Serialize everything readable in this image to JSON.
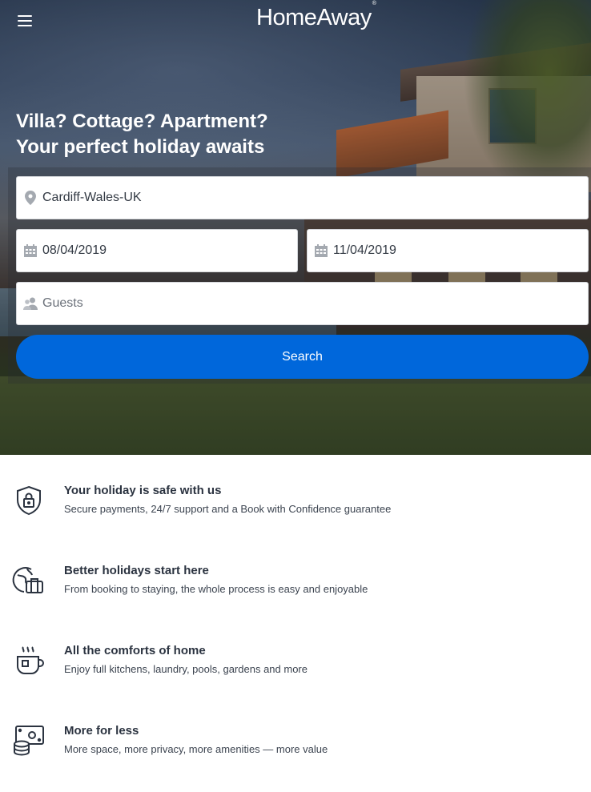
{
  "header": {
    "logo_text": "HomeAway",
    "logo_mark": "®",
    "menu_icon": "hamburger-menu-icon"
  },
  "hero": {
    "headline_line1": "Villa? Cottage? Apartment?",
    "headline_line2": "Your perfect holiday awaits"
  },
  "search": {
    "destination_value": "Cardiff-Wales-UK",
    "checkin_value": "08/04/2019",
    "checkout_value": "11/04/2019",
    "guests_placeholder": "Guests",
    "button_label": "Search",
    "button_color": "#0067db"
  },
  "features": [
    {
      "icon": "shield-lock-icon",
      "title": "Your holiday is safe with us",
      "description": "Secure payments, 24/7 support and a Book with Confidence guarantee"
    },
    {
      "icon": "globe-suitcase-icon",
      "title": "Better holidays start here",
      "description": "From booking to staying, the whole process is easy and enjoyable"
    },
    {
      "icon": "steaming-cup-icon",
      "title": "All the comforts of home",
      "description": "Enjoy full kitchens, laundry, pools, gardens and more"
    },
    {
      "icon": "money-coins-icon",
      "title": "More for less",
      "description": "More space, more privacy, more amenities — more value"
    }
  ]
}
